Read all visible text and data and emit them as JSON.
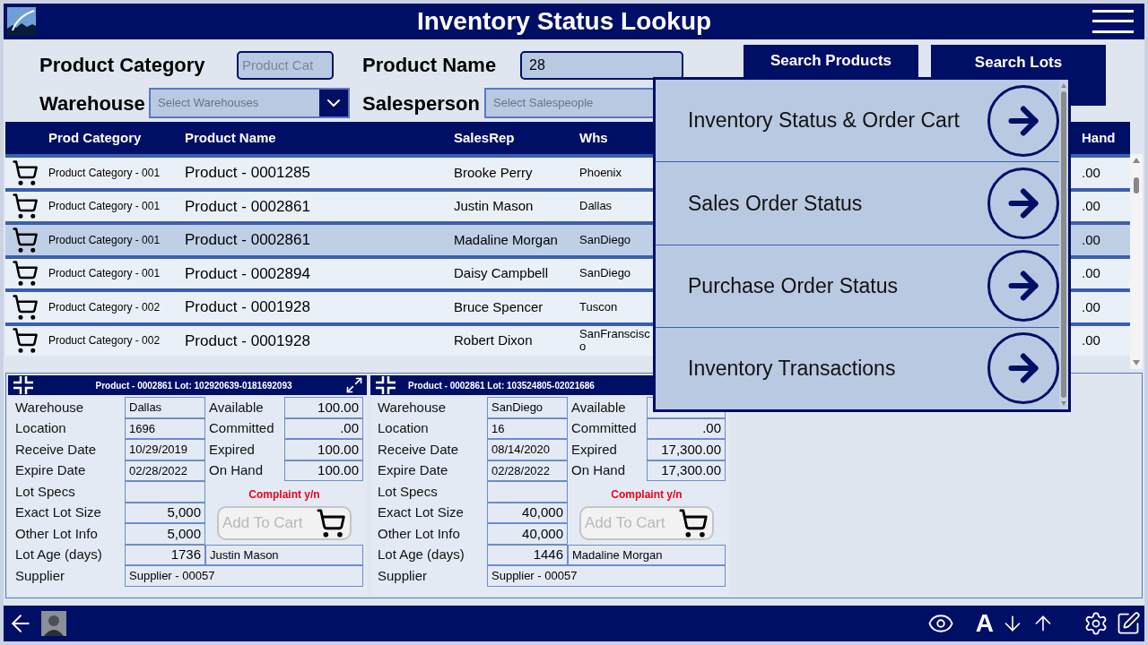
{
  "header": {
    "title": "Inventory Status Lookup"
  },
  "filters": {
    "product_category": {
      "label": "Product Category",
      "placeholder": "Product Cat"
    },
    "product_name": {
      "label": "Product Name",
      "value": "28"
    },
    "warehouse": {
      "label": "Warehouse",
      "placeholder": "Select Warehouses"
    },
    "salesperson": {
      "label": "Salesperson",
      "placeholder": "Select Salespeople"
    }
  },
  "buttons": [
    "Search Products",
    "Search Lots"
  ],
  "table": {
    "columns": [
      "Prod Category",
      "Product Name",
      "SalesRep",
      "Whs",
      "Hand"
    ],
    "rows": [
      {
        "category": "Product Category - 001",
        "product": "Product - 0001285",
        "sales_rep": "Brooke Perry",
        "whs": "Phoenix",
        "hand": ".00",
        "selected": false
      },
      {
        "category": "Product Category - 001",
        "product": "Product - 0002861",
        "sales_rep": "Justin Mason",
        "whs": "Dallas",
        "hand": ".00",
        "selected": false
      },
      {
        "category": "Product Category - 001",
        "product": "Product - 0002861",
        "sales_rep": "Madaline Morgan",
        "whs": "SanDiego",
        "hand": ".00",
        "selected": true
      },
      {
        "category": "Product Category - 001",
        "product": "Product - 0002894",
        "sales_rep": "Daisy Campbell",
        "whs": "SanDiego",
        "hand": ".00",
        "selected": false
      },
      {
        "category": "Product Category - 002",
        "product": "Product - 0001928",
        "sales_rep": "Bruce Spencer",
        "whs": "Tuscon",
        "hand": ".00",
        "selected": false
      },
      {
        "category": "Product Category - 002",
        "product": "Product - 0001928",
        "sales_rep": "Robert Dixon",
        "whs": "SanFranscisco",
        "hand": ".00",
        "selected": false
      }
    ]
  },
  "lot_cards": [
    {
      "title": "Product - 0002861 Lot: 102920639-0181692093",
      "expand": true,
      "fields": [
        {
          "label": "Warehouse",
          "value": "Dallas"
        },
        {
          "label": "Location",
          "value": "1696"
        },
        {
          "label": "Receive Date",
          "value": "10/29/2019"
        },
        {
          "label": "Expire Date",
          "value": "02/28/2022"
        },
        {
          "label": "Lot Specs"
        },
        {
          "label": "Exact Lot Size",
          "value": "5,000"
        },
        {
          "label": "Other Lot Info",
          "value": "5,000"
        },
        {
          "label": "Lot Age (days)",
          "value": "1736"
        },
        {
          "label": "Supplier",
          "value": "Supplier - 00057"
        }
      ],
      "quantities": [
        {
          "label": "Available",
          "value": "100.00"
        },
        {
          "label": "Committed",
          "value": ".00"
        },
        {
          "label": "Expired",
          "value": "100.00"
        },
        {
          "label": "On Hand",
          "value": "100.00"
        }
      ],
      "complaint": "Complaint y/n",
      "add_to_cart": {
        "label": "Add To Cart",
        "disabled": true
      },
      "salesperson": "Justin Mason"
    },
    {
      "title": "Product - 0002861 Lot: 103524805-02021686",
      "expand": false,
      "fields": [
        {
          "label": "Warehouse",
          "value": "SanDiego"
        },
        {
          "label": "Location",
          "value": "16"
        },
        {
          "label": "Receive Date",
          "value": "08/14/2020"
        },
        {
          "label": "Expire Date",
          "value": "02/28/2022"
        },
        {
          "label": "Lot Specs"
        },
        {
          "label": "Exact Lot Size",
          "value": "40,000"
        },
        {
          "label": "Other Lot Info",
          "value": "40,000"
        },
        {
          "label": "Lot Age (days)",
          "value": "1446"
        },
        {
          "label": "Supplier",
          "value": "Supplier - 00057"
        }
      ],
      "quantities": [
        {
          "label": "Available"
        },
        {
          "label": "Committed",
          "value": ".00"
        },
        {
          "label": "Expired",
          "value": "17,300.00"
        },
        {
          "label": "On Hand",
          "value": "17,300.00"
        }
      ],
      "complaint": "Complaint y/n",
      "add_to_cart": {
        "label": "Add To Cart",
        "disabled": true
      },
      "salesperson": "Madaline Morgan"
    }
  ],
  "nav_menu": {
    "items": [
      {
        "label": "Inventory Status & Order Cart"
      },
      {
        "label": "Sales Order Status"
      },
      {
        "label": "Purchase Order Status"
      },
      {
        "label": "Inventory Transactions"
      }
    ]
  },
  "footer": {
    "font_button": "A"
  }
}
